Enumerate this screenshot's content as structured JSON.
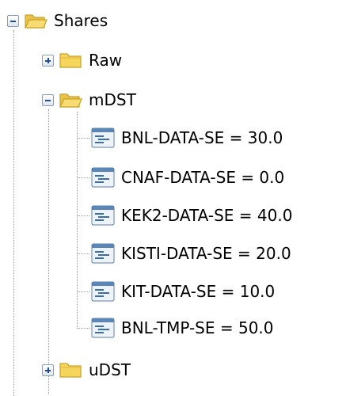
{
  "tree": {
    "root": {
      "label": "Shares",
      "expanded": true,
      "icon": "folder-open-icon"
    },
    "children": [
      {
        "label": "Raw",
        "expanded": false,
        "icon": "folder-closed-icon"
      },
      {
        "label": "mDST",
        "expanded": true,
        "icon": "folder-open-icon",
        "leaves": [
          {
            "label": "BNL-DATA-SE = 30.0",
            "icon": "property-icon"
          },
          {
            "label": "CNAF-DATA-SE = 0.0",
            "icon": "property-icon"
          },
          {
            "label": "KEK2-DATA-SE = 40.0",
            "icon": "property-icon"
          },
          {
            "label": "KISTI-DATA-SE = 20.0",
            "icon": "property-icon"
          },
          {
            "label": "KIT-DATA-SE = 10.0",
            "icon": "property-icon"
          },
          {
            "label": "BNL-TMP-SE = 50.0",
            "icon": "property-icon"
          }
        ]
      },
      {
        "label": "uDST",
        "expanded": false,
        "icon": "folder-closed-icon"
      }
    ]
  },
  "colors": {
    "folder_fill": "#f5d55c",
    "folder_edge": "#c9a227",
    "connector": "#9a9a9a",
    "toggle_sign": "#1f4f8a",
    "property_icon": "#3a6ea5"
  }
}
